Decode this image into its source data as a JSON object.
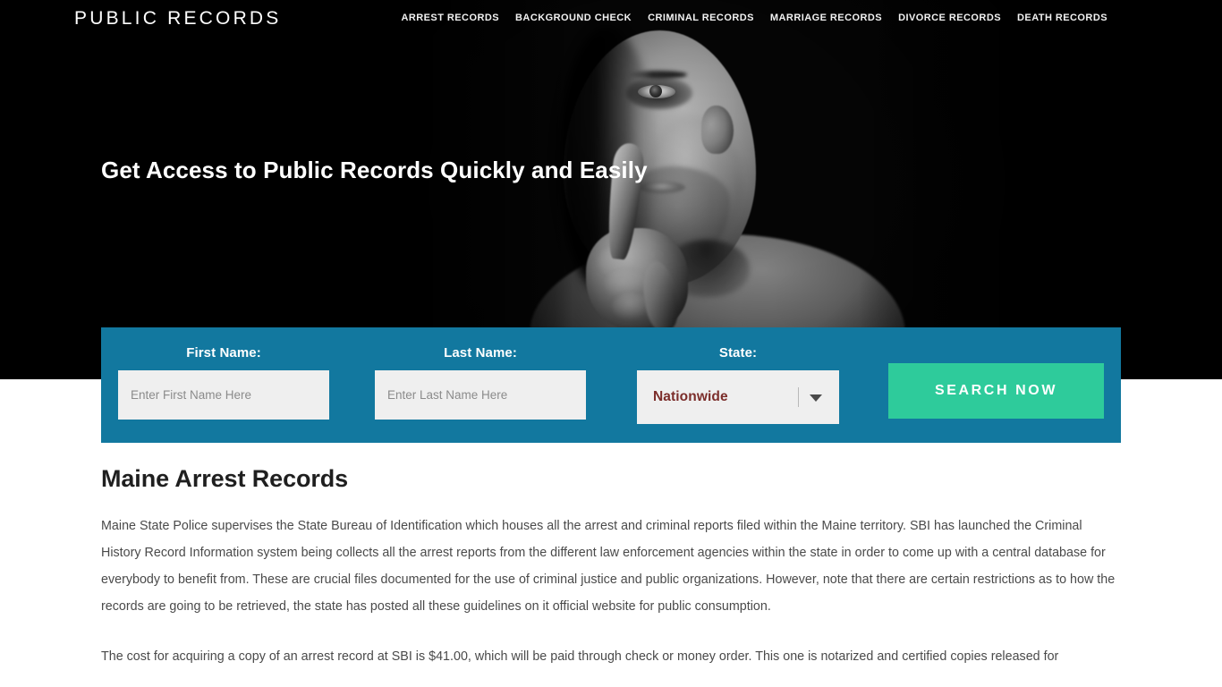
{
  "header": {
    "brand": "PUBLIC RECORDS",
    "nav_items": [
      {
        "label": "ARREST RECORDS"
      },
      {
        "label": "BACKGROUND CHECK"
      },
      {
        "label": "CRIMINAL RECORDS"
      },
      {
        "label": "MARRIAGE RECORDS"
      },
      {
        "label": "DIVORCE RECORDS"
      },
      {
        "label": "DEATH RECORDS"
      }
    ]
  },
  "hero": {
    "headline": "Get Access to Public Records Quickly and Easily",
    "image_description": "grayscale-portrait-man-finger-on-lips-shh-gesture",
    "background_color": "#000000"
  },
  "search_form": {
    "panel_color": "#12789f",
    "first_name": {
      "label": "First Name:",
      "placeholder": "Enter First Name Here",
      "value": ""
    },
    "last_name": {
      "label": "Last Name:",
      "placeholder": "Enter Last Name Here",
      "value": ""
    },
    "state": {
      "label": "State:",
      "selected": "Nationwide",
      "value_color": "#7b2d2a",
      "arrow_icon": "chevron-down-icon"
    },
    "submit": {
      "label": "SEARCH NOW",
      "color": "#2ecb9b"
    }
  },
  "main": {
    "title": "Maine Arrest Records",
    "paragraphs": [
      "Maine State Police supervises the State Bureau of Identification which houses all the arrest and criminal reports filed within the Maine territory. SBI has launched the Criminal History Record Information system being collects all the arrest reports from the different law enforcement agencies within the state in order to come up with a central database for everybody to benefit from. These are crucial files documented for the use of criminal justice and public organizations. However, note that there are certain restrictions as to how the records are going to be retrieved, the state has posted all these guidelines on it official website for public consumption.",
      "The cost for acquiring a copy of an arrest record at SBI is $41.00, which will be paid through check or money order. This one is notarized and certified copies released for"
    ]
  }
}
